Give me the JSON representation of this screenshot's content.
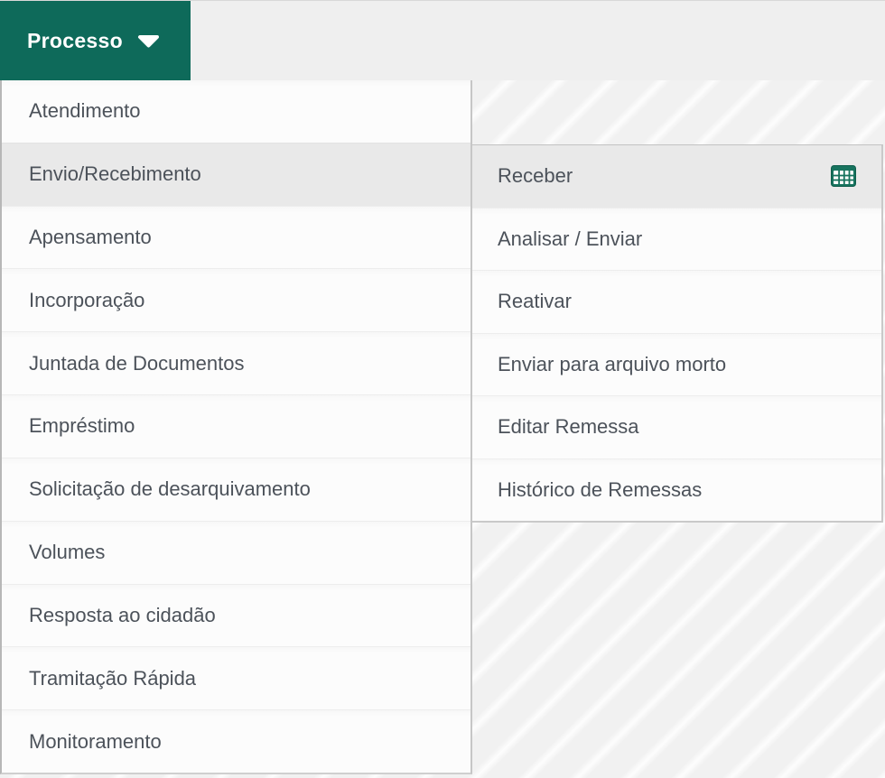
{
  "menubar": {
    "process_button": {
      "label": "Processo",
      "caret_icon": "caret-down-icon"
    }
  },
  "colors": {
    "accent_green": "#0e6a5a",
    "highlight_gray": "#e9e9e9",
    "menu_text": "#4c525a",
    "icon_table_green": "#17735e"
  },
  "menu": {
    "items": [
      {
        "label": "Atendimento",
        "active": false
      },
      {
        "label": "Envio/Recebimento",
        "active": true
      },
      {
        "label": "Apensamento",
        "active": false
      },
      {
        "label": "Incorporação",
        "active": false
      },
      {
        "label": "Juntada de Documentos",
        "active": false
      },
      {
        "label": "Empréstimo",
        "active": false
      },
      {
        "label": "Solicitação de desarquivamento",
        "active": false
      },
      {
        "label": "Volumes",
        "active": false
      },
      {
        "label": "Resposta ao cidadão",
        "active": false
      },
      {
        "label": "Tramitação Rápida",
        "active": false
      },
      {
        "label": "Monitoramento",
        "active": false
      }
    ]
  },
  "submenu": {
    "items": [
      {
        "label": "Receber",
        "active": true,
        "icon": "table-grid-icon"
      },
      {
        "label": "Analisar / Enviar",
        "active": false
      },
      {
        "label": "Reativar",
        "active": false
      },
      {
        "label": "Enviar para arquivo morto",
        "active": false
      },
      {
        "label": "Editar Remessa",
        "active": false
      },
      {
        "label": "Histórico de Remessas",
        "active": false
      }
    ]
  }
}
